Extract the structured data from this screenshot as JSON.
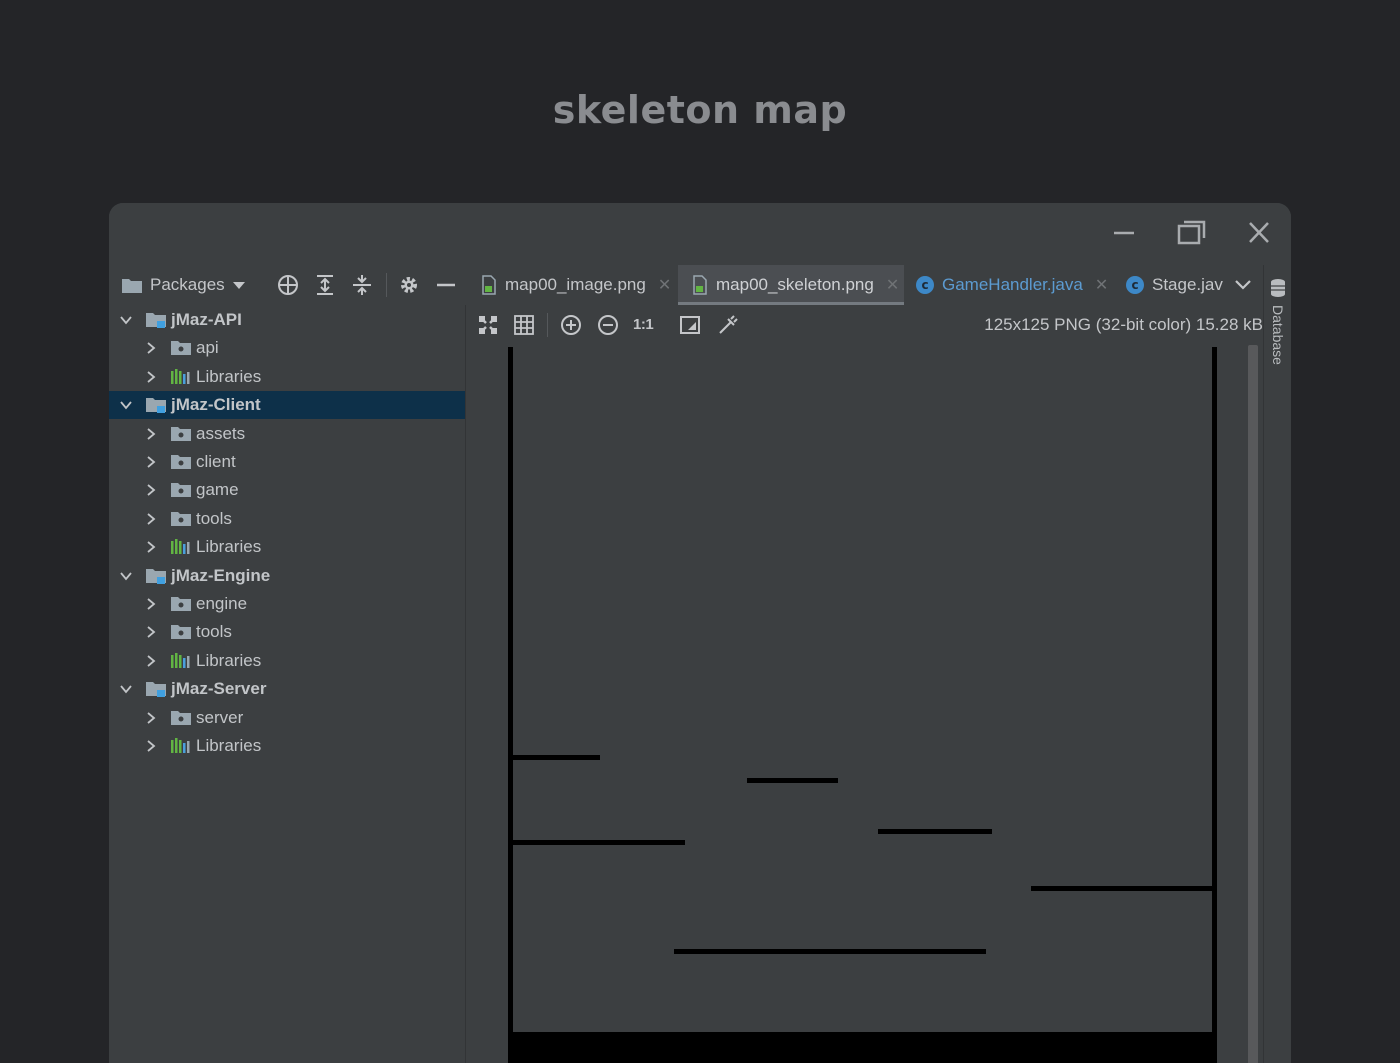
{
  "page": {
    "heading": "skeleton map"
  },
  "window": {
    "controls": {
      "minimize": "minimize",
      "maximize": "maximize",
      "close": "close"
    }
  },
  "project_panel": {
    "view_selector": "Packages",
    "tree": [
      {
        "label": "jMaz-API",
        "level": 0,
        "expanded": true,
        "icon": "module-icon"
      },
      {
        "label": "api",
        "level": 1,
        "icon": "package-folder-icon"
      },
      {
        "label": "Libraries",
        "level": 1,
        "icon": "libraries-icon"
      },
      {
        "label": "jMaz-Client",
        "level": 0,
        "expanded": true,
        "icon": "module-icon",
        "selected": true
      },
      {
        "label": "assets",
        "level": 1,
        "icon": "package-folder-icon"
      },
      {
        "label": "client",
        "level": 1,
        "icon": "package-folder-icon"
      },
      {
        "label": "game",
        "level": 1,
        "icon": "package-folder-icon"
      },
      {
        "label": "tools",
        "level": 1,
        "icon": "package-folder-icon"
      },
      {
        "label": "Libraries",
        "level": 1,
        "icon": "libraries-icon"
      },
      {
        "label": "jMaz-Engine",
        "level": 0,
        "expanded": true,
        "icon": "module-icon"
      },
      {
        "label": "engine",
        "level": 1,
        "icon": "package-folder-icon"
      },
      {
        "label": "tools",
        "level": 1,
        "icon": "package-folder-icon"
      },
      {
        "label": "Libraries",
        "level": 1,
        "icon": "libraries-icon"
      },
      {
        "label": "jMaz-Server",
        "level": 0,
        "expanded": true,
        "icon": "module-icon"
      },
      {
        "label": "server",
        "level": 1,
        "icon": "package-folder-icon"
      },
      {
        "label": "Libraries",
        "level": 1,
        "icon": "libraries-icon"
      }
    ]
  },
  "editor": {
    "tabs": [
      {
        "label": "map00_image.png",
        "icon": "image-file-icon",
        "closable": true,
        "active": false
      },
      {
        "label": "map00_skeleton.png",
        "icon": "image-file-icon",
        "closable": true,
        "active": true
      },
      {
        "label": "GameHandler.java",
        "icon": "class-icon",
        "closable": true,
        "active": false
      },
      {
        "label": "Stage.jav",
        "icon": "class-icon",
        "closable": false,
        "active": false
      }
    ],
    "more_tabs_icon": "chevron-down-icon",
    "image_toolbar": {
      "one_to_one_label": "1:1",
      "info": "125x125 PNG (32-bit color) 15.28 kB"
    }
  },
  "right_panel": {
    "database_label": "Database"
  },
  "colors": {
    "page_bg": "#242528",
    "panel_bg": "#3c3f41",
    "selection_bg": "#0d3049",
    "class_icon": "#3d88c7",
    "folder_icon": "#9aa7b0",
    "module_badge": "#40a0e0",
    "library_green": "#62b543",
    "library_blue": "#4a9fdc",
    "skeleton_line": "#000000"
  }
}
